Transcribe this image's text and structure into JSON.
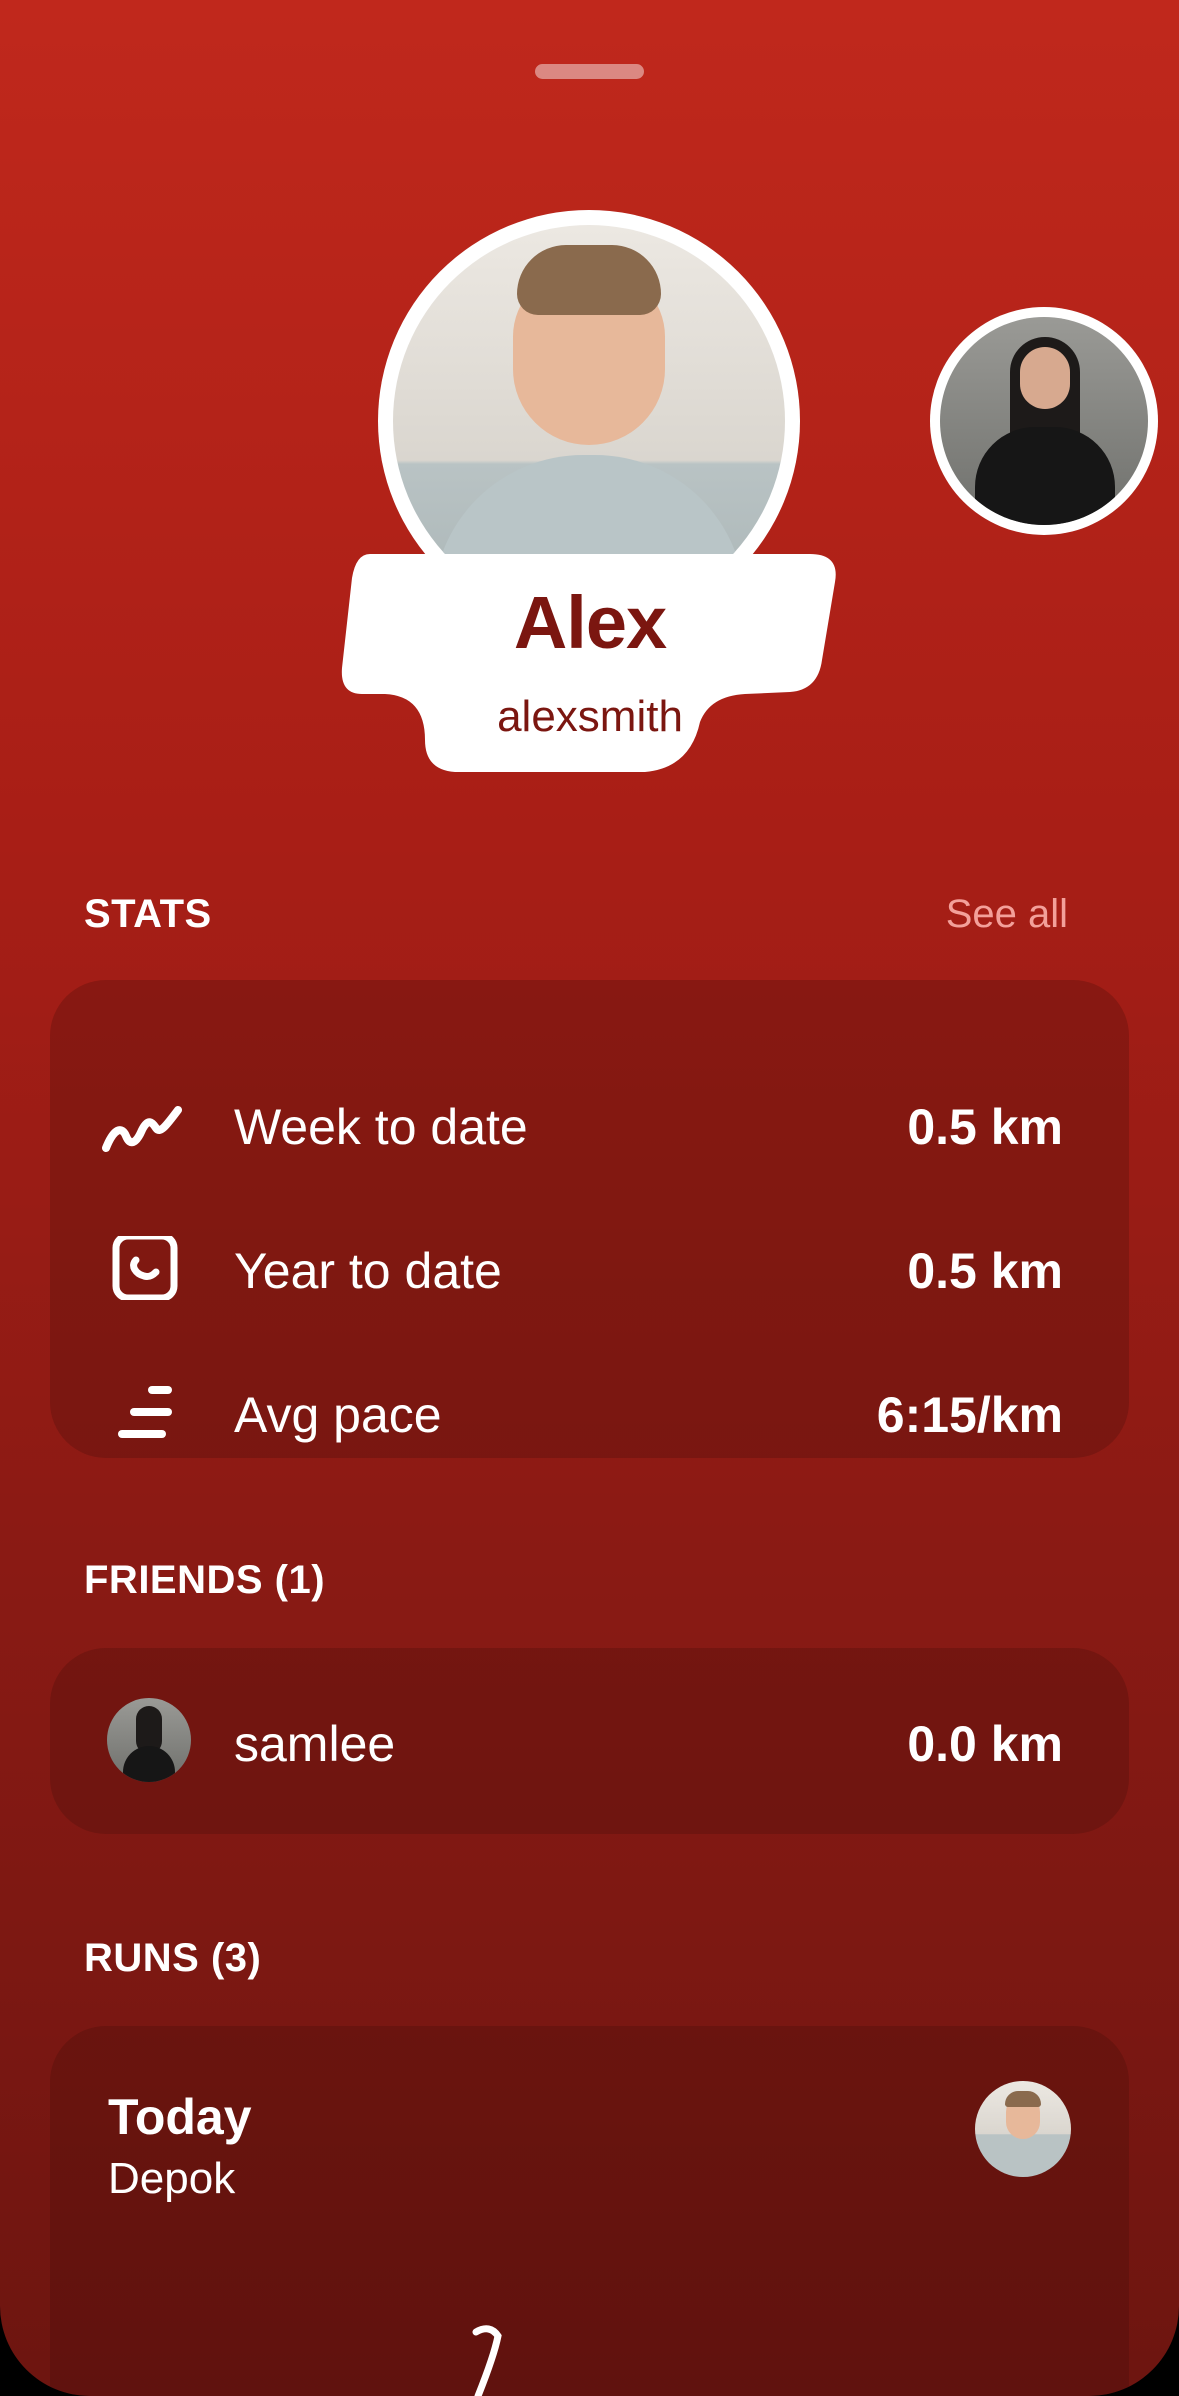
{
  "profile": {
    "name": "Alex",
    "username": "alexsmith"
  },
  "stats": {
    "title": "STATS",
    "see_all": "See all",
    "rows": [
      {
        "icon": "trend-squiggle-icon",
        "label": "Week to date",
        "value": "0.5 km"
      },
      {
        "icon": "calendar-year-icon",
        "label": "Year to date",
        "value": "0.5 km"
      },
      {
        "icon": "pace-lines-icon",
        "label": "Avg pace",
        "value": "6:15/km"
      }
    ]
  },
  "friends": {
    "title": "FRIENDS (1)",
    "items": [
      {
        "username": "samlee",
        "distance": "0.0 km"
      }
    ]
  },
  "runs": {
    "title": "RUNS (3)",
    "items": [
      {
        "day": "Today",
        "location": "Depok"
      }
    ]
  },
  "colors": {
    "accent": "#c0281c",
    "name_text": "#7b1610",
    "see_all": "#f3a09a"
  }
}
